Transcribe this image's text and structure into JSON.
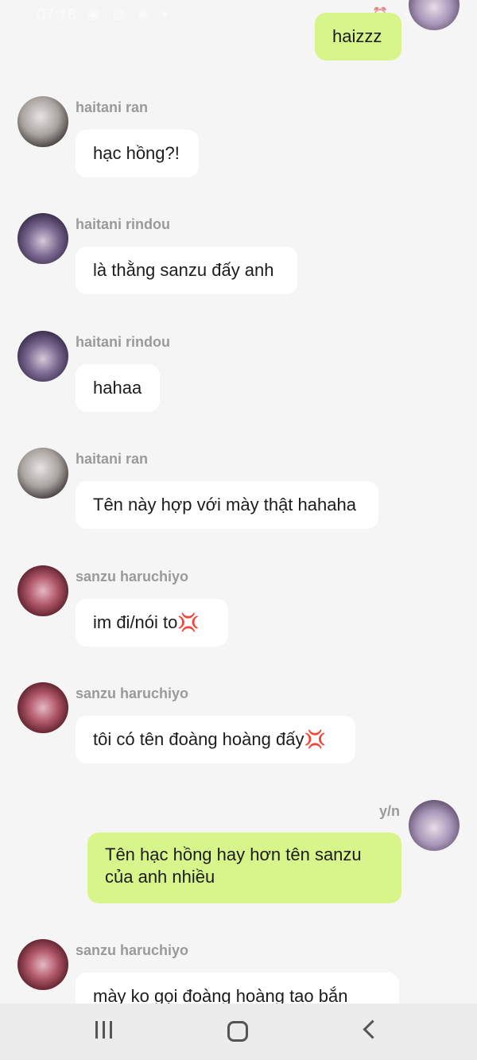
{
  "status_bar": {
    "time": "07:18",
    "left_icons": [
      "image-icon",
      "message-icon",
      "messenger-icon",
      "dropdown-icon"
    ],
    "right_icons": [
      "alarm-icon",
      "wifi-icon",
      "signal-icon",
      "battery-icon"
    ]
  },
  "messages": [
    {
      "sender": "",
      "text": "haizzz",
      "mine": true,
      "avatar": "y/n"
    },
    {
      "sender": "haitani ran",
      "text": "hạc hồng?!",
      "mine": false
    },
    {
      "sender": "haitani rindou",
      "text": "là thằng sanzu đấy anh",
      "mine": false
    },
    {
      "sender": "haitani rindou",
      "text": "hahaa",
      "mine": false
    },
    {
      "sender": "haitani ran",
      "text": "Tên này hợp với mày thật hahaha",
      "mine": false
    },
    {
      "sender": "sanzu haruchiyo",
      "text": "im đi/nói to💢",
      "mine": false
    },
    {
      "sender": "sanzu haruchiyo",
      "text": "tôi có tên đoàng hoàng đấy💢",
      "mine": false
    },
    {
      "sender": "y/n",
      "text": "Tên hạc hồng hay hơn tên sanzu của anh nhiều",
      "mine": true
    },
    {
      "sender": "sanzu haruchiyo",
      "text": "mày ko gọi đoàng hoàng tao bắn",
      "mine": false
    }
  ],
  "nav": {
    "recent_icon": "recent-apps-icon",
    "home_icon": "home-icon",
    "back_icon": "back-icon"
  },
  "colors": {
    "background": "#f5f5f5",
    "bubble_other": "#ffffff",
    "bubble_mine": "#d8f58c",
    "sender_name": "#9a9a9a"
  }
}
